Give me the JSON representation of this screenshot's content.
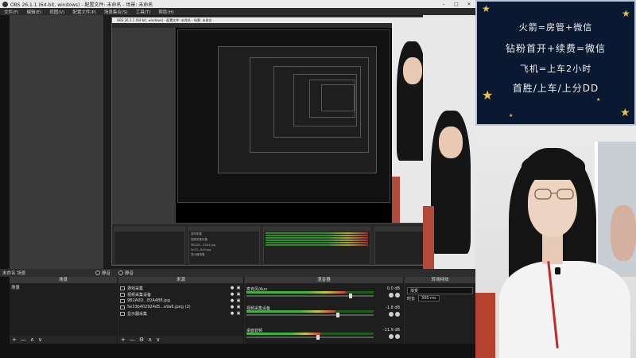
{
  "window": {
    "title": "OBS 26.1.1 (64-bit, windows) - 配置文件: 未命名 - 场景: 未命名",
    "controls": [
      "–",
      "□",
      "✕"
    ]
  },
  "menu": [
    "文件(F)",
    "编辑(E)",
    "视图(V)",
    "配置文件(P)",
    "场景集合(S)",
    "工具(T)",
    "帮助(H)"
  ],
  "stats": {
    "label": "未命名 场景",
    "mic_label": "静音",
    "desktop_label": "静音"
  },
  "nested": {
    "title": "OBS 26.1.1 (64-bit, windows) - 配置文件: 未命名 - 场景: 未命名",
    "sources": [
      "游戏采集",
      "视频采集设备",
      "9B2AD…E0A4.jpg",
      "5e33...84d.jpg",
      "显示器采集"
    ]
  },
  "scenes": {
    "header": "场景",
    "items": [
      "场景"
    ]
  },
  "sources": {
    "header": "来源",
    "items": [
      {
        "name": "游戏采集",
        "icon": "gamepad-icon"
      },
      {
        "name": "视频采集设备",
        "icon": "camera-icon"
      },
      {
        "name": "9B2A0D...E0A4B8.jpg",
        "icon": "image-icon"
      },
      {
        "name": "5e33b402924d5...e9a6.jpeg (2)",
        "icon": "image-icon"
      },
      {
        "name": "显示器采集",
        "icon": "monitor-icon"
      }
    ]
  },
  "mixer": {
    "header": "混音器",
    "channels": [
      {
        "name": "麦克风/Aux",
        "db": "0.0 dB",
        "level": 0.78,
        "fader": 0.82
      },
      {
        "name": "视频采集设备",
        "db": "-1.8 dB",
        "level": 0.7,
        "fader": 0.72
      },
      {
        "name": "桌面音频",
        "db": "-11.9 dB",
        "level": 0.58,
        "fader": 0.56
      }
    ]
  },
  "transitions": {
    "header": "转场特效",
    "type": "渐变",
    "duration_label": "时长",
    "duration": "300 ms"
  },
  "foot": {
    "add": "+",
    "remove": "—",
    "settings": "⚙",
    "up": "∧",
    "down": "∨"
  },
  "overlay": {
    "lines": [
      "火箭=房管+微信",
      "钻粉首开+续费=微信",
      "飞机=上车2小时",
      "首胜/上车/上分DD"
    ]
  },
  "colors": {
    "overlay_bg": "#0a1832",
    "star": "#e8c44a",
    "meter_green": "#3fb03f",
    "meter_yellow": "#c8c83a",
    "meter_red": "#c83a3a"
  }
}
